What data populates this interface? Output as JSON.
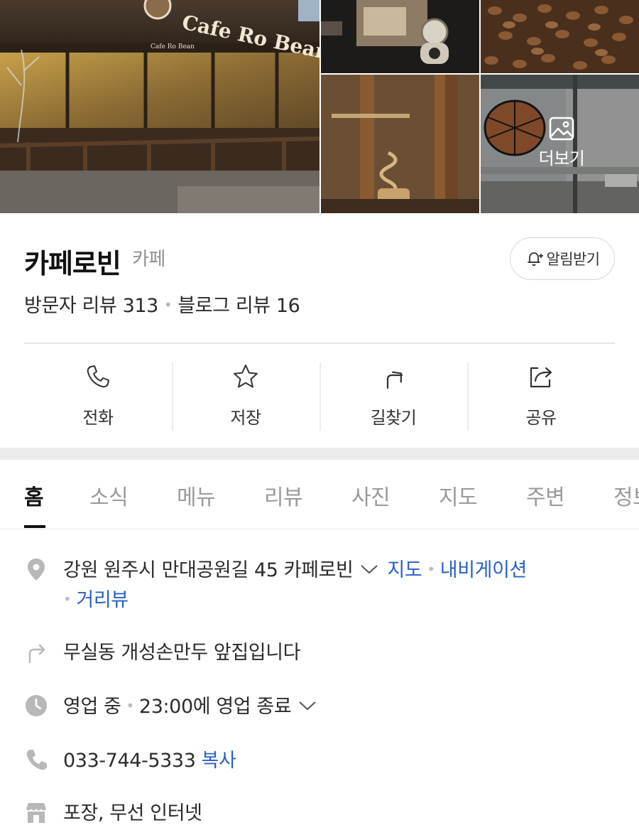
{
  "photos": {
    "storefront_sign": "Cafe Ro Bean",
    "storefront_small_sign": "Cafe Ro Bean",
    "more_label": "더보기"
  },
  "place": {
    "name": "카페로빈",
    "category": "카페",
    "alarm_label": "알림받기",
    "visitor_reviews": "방문자 리뷰 313",
    "blog_reviews": "블로그 리뷰 16"
  },
  "actions": [
    {
      "label": "전화",
      "icon": "phone-icon"
    },
    {
      "label": "저장",
      "icon": "star-icon"
    },
    {
      "label": "길찾기",
      "icon": "directions-icon"
    },
    {
      "label": "공유",
      "icon": "share-icon"
    }
  ],
  "tabs": [
    "홈",
    "소식",
    "메뉴",
    "리뷰",
    "사진",
    "지도",
    "주변",
    "정보"
  ],
  "info": {
    "address": "강원 원주시 만대공원길 45 카페로빈",
    "address_links": [
      "지도",
      "내비게이션",
      "거리뷰"
    ],
    "directions_hint": "무실동 개성손만두 앞집입니다",
    "hours_status": "영업 중",
    "hours_detail": "23:00에 영업 종료",
    "phone": "033-744-5333",
    "copy_label": "복사",
    "amenities": "포장, 무선 인터넷"
  },
  "colors": {
    "link": "#2a5fc7",
    "icon_gray": "#b8b8b8",
    "divider": "#e6e6e6"
  }
}
